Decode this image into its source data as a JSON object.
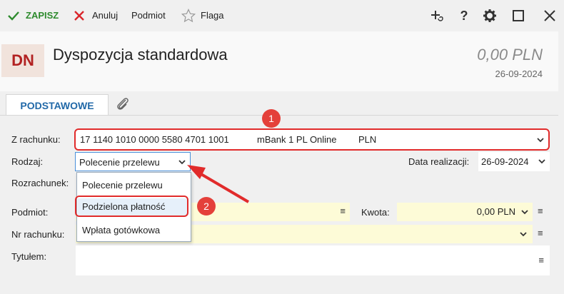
{
  "toolbar": {
    "save_label": "ZAPISZ",
    "cancel_label": "Anuluj",
    "subject_label": "Podmiot",
    "flag_label": "Flaga",
    "help_glyph": "?"
  },
  "header": {
    "badge": "DN",
    "title": "Dyspozycja standardowa",
    "amount": "0,00 PLN",
    "date": "26-09-2024"
  },
  "tabs": {
    "basic": "PODSTAWOWE"
  },
  "form": {
    "from_account_label": "Z rachunku:",
    "from_account_number": "17 1140 1010 0000 5580 4701 1001",
    "from_account_bank": "mBank 1 PL Online",
    "from_account_currency": "PLN",
    "type_label": "Rodzaj:",
    "type_value": "Polecenie przelewu",
    "date_label": "Data realizacji:",
    "date_value": "26-09-2024",
    "settlement_label": "Rozrachunek:",
    "subject_label": "Podmiot:",
    "amount_label": "Kwota:",
    "amount_value": "0,00 PLN",
    "account_no_label": "Nr rachunku:",
    "title_label": "Tytułem:"
  },
  "dropdown": {
    "options": [
      "Polecenie przelewu",
      "Podzielona płatność",
      "Wpłata gotówkowa"
    ]
  },
  "callouts": [
    "1",
    "2"
  ],
  "colors": {
    "accent_blue": "#2269a8",
    "save_green": "#2e8b2e",
    "cancel_red": "#d9262b",
    "badge_bg": "#f1e3dc",
    "badge_text": "#b22222",
    "highlight_red": "#e12b2b",
    "required_yellow": "#fdfbd7"
  }
}
